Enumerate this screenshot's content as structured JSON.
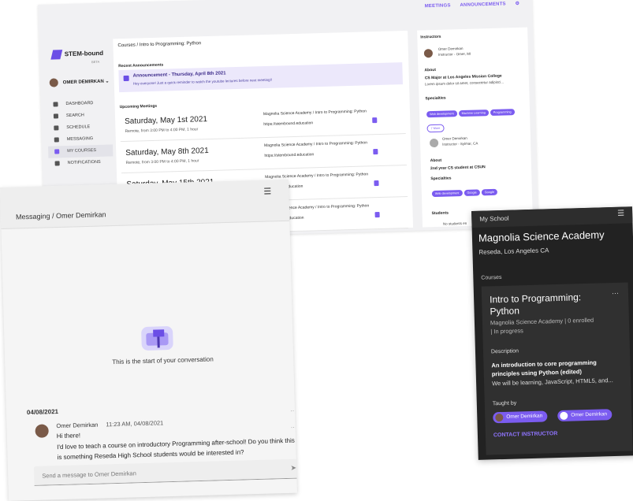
{
  "desktop": {
    "nav": {
      "meetings": "MEETINGS",
      "announcements": "ANNOUNCEMENTS"
    },
    "brand": {
      "name": "STEM-bound",
      "beta": "BETA"
    },
    "user": "OMER DEMIRKAN",
    "sidebar": [
      "DASHBOARD",
      "SEARCH",
      "SCHEDULE",
      "MESSAGING",
      "MY COURSES",
      "NOTIFICATIONS"
    ],
    "breadcrumb": "Courses / Intro to Programming: Python",
    "recent_announcements": "Recent Announcements",
    "announcement": {
      "title": "Announcement - Thursday, April 8th 2021",
      "text": "Hey everyone! Just a quick reminder to watch the youtube lectures before next meeting!!"
    },
    "upcoming_meetings": "Upcoming Meetings",
    "meetings": [
      {
        "date": "Saturday, May 1st 2021",
        "time": "Remote, from 3:00 PM to 4:00 PM, 1 hour",
        "course": "Magnolia Science Academy / Intro to Programming: Python",
        "url": "https://stembound.education"
      },
      {
        "date": "Saturday, May 8th 2021",
        "time": "Remote, from 3:00 PM to 4:00 PM, 1 hour",
        "course": "Magnolia Science Academy / Intro to Programming: Python",
        "url": "https://stembound.education"
      },
      {
        "date": "Saturday, May 15th 2021",
        "time": "",
        "course": "Magnolia Science Academy / Intro to Programming: Python",
        "url": "stembound.education"
      },
      {
        "date": "",
        "time": "",
        "course": "Magnolia Science Academy / Intro to Programming: Python",
        "url": "stembound.education"
      }
    ],
    "instructors": "Instructors",
    "instructor1": {
      "name": "Omer Demirkan",
      "role": "Instructor - Omer, MI",
      "about": "About",
      "about_title": "CS Major at Los Angeles Mission College",
      "about_text": "Lorem ipsum dolor sit amet, consectetur adipisci...",
      "specialties": "Specialties",
      "chips": [
        "Web development",
        "Machine Learning",
        "Programming",
        "7 More"
      ]
    },
    "instructor2": {
      "name": "Omer Demirkan",
      "role": "Instructor - Sylmar, CA",
      "about": "About",
      "about_title": "2nd year CS student at CSUN",
      "specialties": "Specialties",
      "chips": [
        "Web development",
        "Google",
        "Google"
      ]
    },
    "students": "Students",
    "no_students": "No students en"
  },
  "messaging": {
    "breadcrumb": "Messaging / Omer Demirkan",
    "start": "This is the start of your conversation",
    "date": "04/08/2021",
    "sender": "Omer Demirkan",
    "time": "11:23 AM, 04/08/2021",
    "lines": [
      "Hi there!",
      "I'd love to teach a course on introductory Programming after-school! Do you think this",
      "is something Reseda High School students would be interested in?"
    ],
    "placeholder": "Send a message to Omer Demirkan"
  },
  "school": {
    "header": "My School",
    "name": "Magnolia Science Academy",
    "location": "Reseda, Los Angeles CA",
    "courses_label": "Courses",
    "course_title": "Intro to Programming: Python",
    "course_sub1": "Magnolia Science Academy | 0 enrolled",
    "course_sub2": "| In progress",
    "description_label": "Description",
    "desc_line1": "An introduction to core programming",
    "desc_line2": "principles using Python (edited)",
    "desc_line3": "We will be learning, JavaScript, HTML5, and...",
    "taught_by": "Taught by",
    "teachers": [
      "Omer Demirkan",
      "Omer Demirkan"
    ],
    "contact": "CONTACT INSTRUCTOR"
  },
  "colors": {
    "accent": "#7b5cf0",
    "dark": "#222222"
  }
}
